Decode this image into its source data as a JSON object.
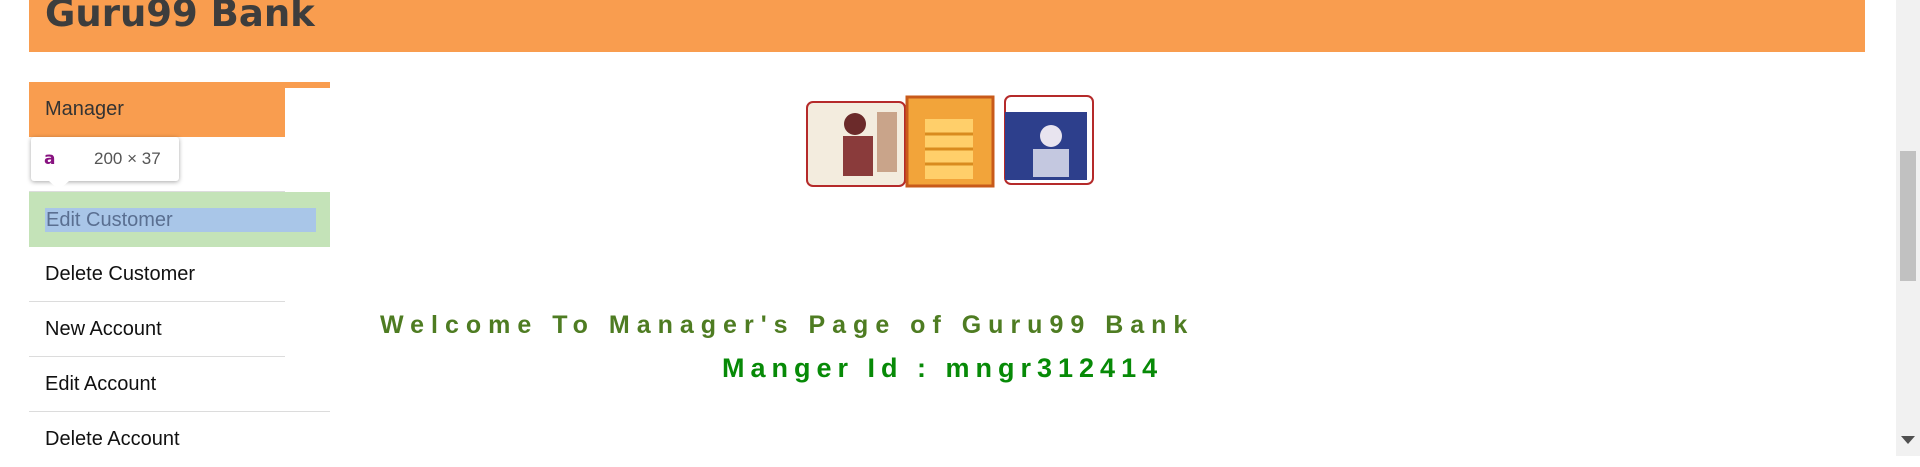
{
  "header": {
    "title": "Guru99 Bank"
  },
  "sidebar": {
    "items": [
      {
        "label": "Manager"
      },
      {
        "label": ""
      },
      {
        "label": "Edit Customer"
      },
      {
        "label": "Delete Customer"
      },
      {
        "label": "New Account"
      },
      {
        "label": "Edit Account"
      },
      {
        "label": "Delete Account"
      }
    ]
  },
  "tooltip": {
    "tag": "a",
    "dimensions": "200 × 37"
  },
  "main": {
    "welcome_text": "Welcome To Manager's Page of Guru99 Bank",
    "manager_id_text": "Manger Id : mngr312414"
  },
  "colors": {
    "header_bg": "#f99d4f",
    "highlight_bg": "#c4e3b8",
    "selection_bg": "#a9c6e8",
    "welcome_text": "#4e7c22",
    "manager_id_text": "#078a07"
  }
}
